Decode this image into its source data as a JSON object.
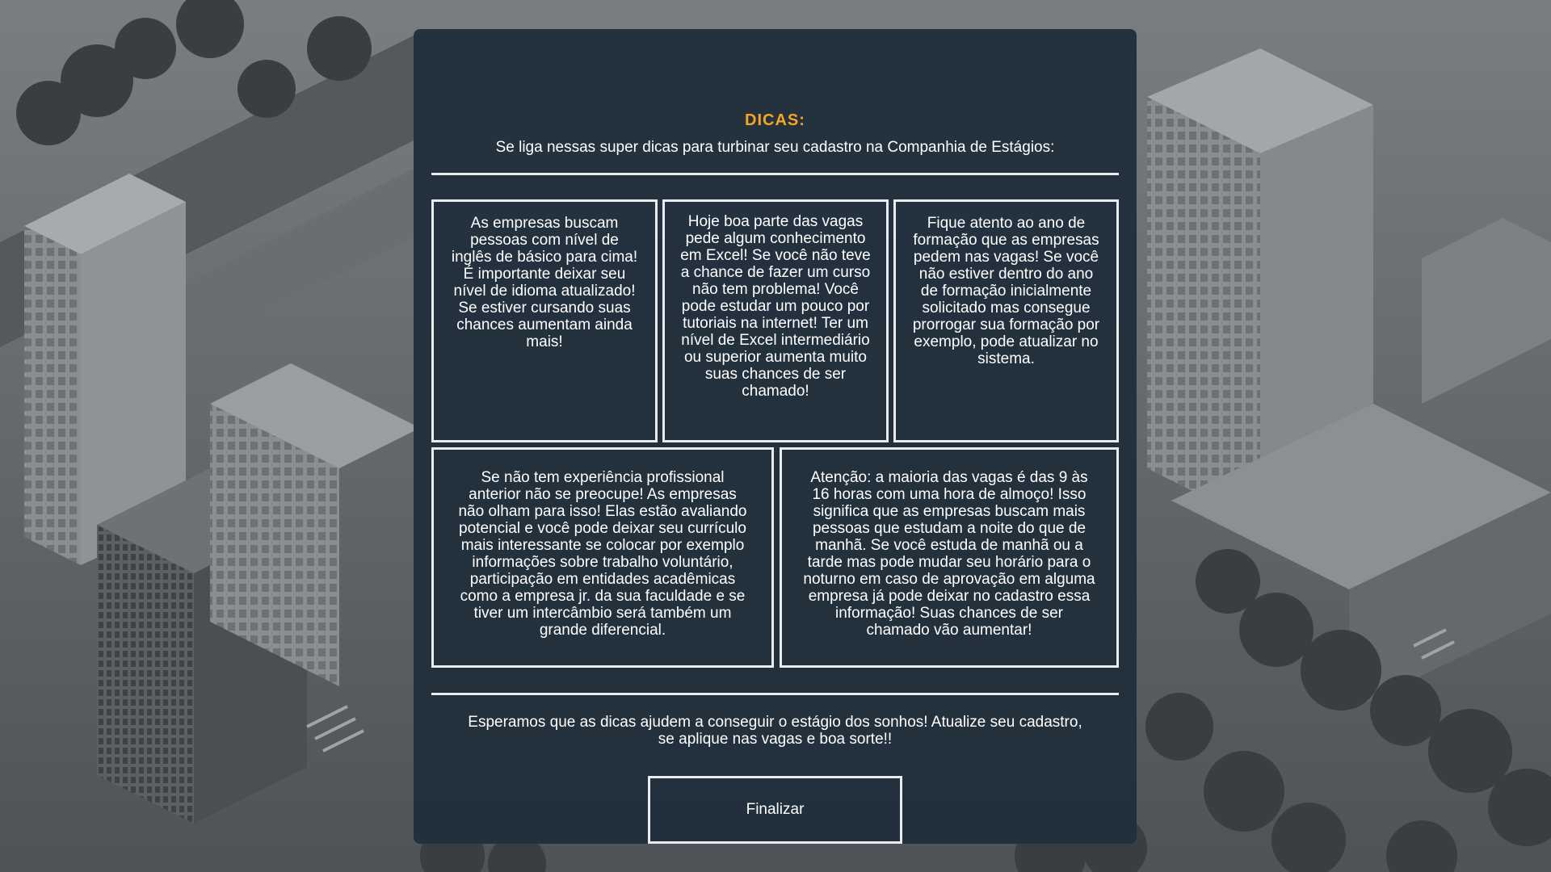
{
  "colors": {
    "panel_bg": "#21303c",
    "accent": "#f5a623",
    "text": "#ffffff",
    "border": "#e9ecef"
  },
  "header": {
    "title": "DICAS:",
    "subtitle": "Se liga nessas super dicas para turbinar seu cadastro na Companhia de Estágios:"
  },
  "tips": [
    {
      "text": "As empresas buscam pessoas com nível de inglês de básico para cima! É importante deixar seu nível de idioma atualizado! Se estiver cursando suas chances aumentam ainda mais!"
    },
    {
      "text": "Hoje boa parte das vagas pede algum conhecimento em Excel! Se você não teve a chance de fazer um curso não tem problema! Você pode estudar um pouco por tutoriais na internet! Ter um nível de Excel intermediário ou superior aumenta muito suas chances de ser chamado!"
    },
    {
      "text": "Fique atento ao ano de formação que as empresas pedem nas vagas! Se você não estiver dentro do ano de formação inicialmente solicitado mas consegue prorrogar sua formação por exemplo, pode atualizar no sistema."
    },
    {
      "text": "Se não tem experiência profissional anterior não se preocupe! As empresas não olham para isso! Elas estão avaliando potencial e você pode deixar seu currículo mais interessante se colocar por exemplo informações sobre trabalho voluntário, participação em entidades acadêmicas como a empresa jr. da sua faculdade e se tiver um intercâmbio será também um grande diferencial."
    },
    {
      "text": "Atenção: a maioria das vagas é das 9 às 16 horas com uma hora de almoço! Isso significa que as empresas buscam mais pessoas que estudam a noite do que de manhã. Se você estuda de manhã ou a tarde mas pode mudar seu horário para o noturno em caso de aprovação em alguma empresa já pode deixar no cadastro essa informação! Suas chances de ser chamado vão aumentar!"
    }
  ],
  "footer": {
    "closing": "Esperamos que as dicas ajudem a conseguir o estágio dos sonhos! Atualize seu cadastro, se aplique nas vagas e boa sorte!!",
    "finish_label": "Finalizar"
  },
  "background": {
    "description_icon": "isometric-city-icon"
  }
}
